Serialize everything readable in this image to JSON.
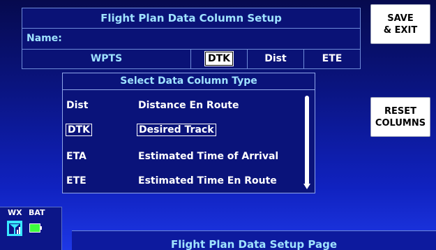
{
  "top_panel": {
    "title": "Flight Plan Data Column Setup",
    "name_label": "Name:",
    "columns": [
      "WPTS",
      "DTK",
      "Dist",
      "ETE"
    ],
    "selected_column": "DTK"
  },
  "buttons": {
    "save_exit": "SAVE\n& EXIT",
    "reset_columns": "RESET\nCOLUMNS"
  },
  "dialog": {
    "title": "Select Data Column Type",
    "options": [
      {
        "code": "Dist",
        "desc": "Distance En Route"
      },
      {
        "code": "DTK",
        "desc": "Desired Track"
      },
      {
        "code": "ETA",
        "desc": "Estimated Time of Arrival"
      },
      {
        "code": "ETE",
        "desc": "Estimated Time En Route"
      }
    ],
    "selected_option": "DTK"
  },
  "status": {
    "wx_label": "WX",
    "bat_label": "BAT",
    "wx_icon": "signal-bars-icon",
    "bat_icon": "battery-icon"
  },
  "footer": {
    "page_title": "Flight Plan Data Setup Page"
  },
  "colors": {
    "accent_text": "#9fe3ff",
    "button_bg": "#ffffff",
    "battery_green": "#3cff3c",
    "wx_cyan": "#39e7ff"
  }
}
